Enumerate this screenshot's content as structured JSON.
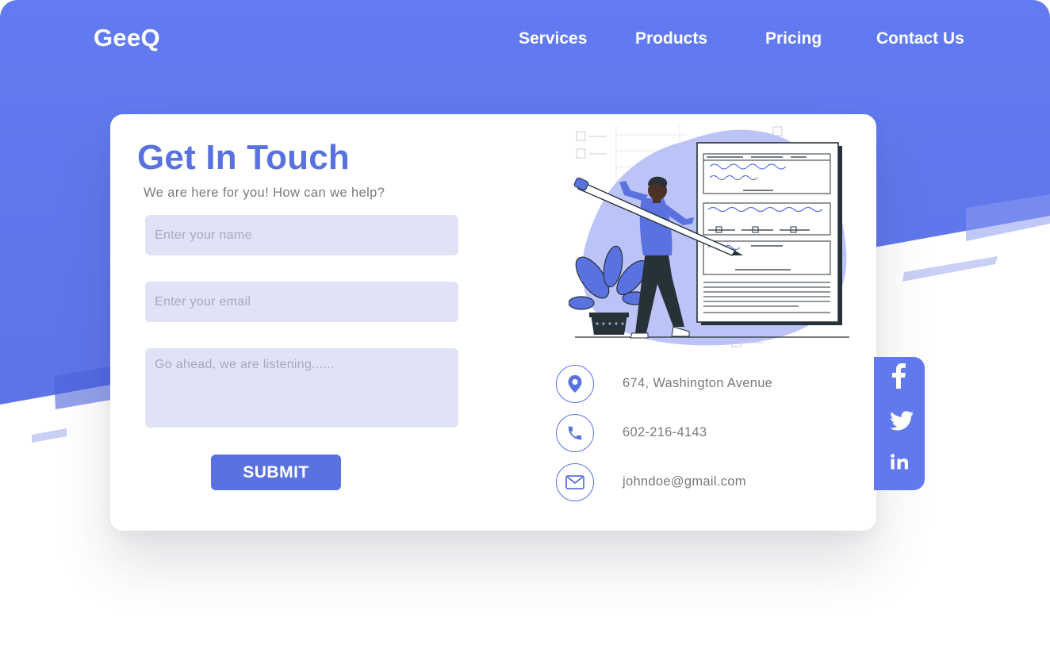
{
  "brand": {
    "name": "GeeQ"
  },
  "nav": {
    "items": [
      {
        "label": "Services"
      },
      {
        "label": "Products"
      },
      {
        "label": "Pricing"
      },
      {
        "label": "Contact Us"
      }
    ]
  },
  "contact_form": {
    "title": "Get In Touch",
    "subtitle": "We are here for you! How can we help?",
    "name_placeholder": "Enter your name",
    "email_placeholder": "Enter your email",
    "message_placeholder": "Go ahead, we are listening......",
    "submit_label": "SUBMIT"
  },
  "contact_info": {
    "address": {
      "icon": "map-pin-icon",
      "text": "674, Washington Avenue"
    },
    "phone": {
      "icon": "phone-icon",
      "text": "602-216-4143"
    },
    "email": {
      "icon": "envelope-icon",
      "text": "johndoe@gmail.com"
    }
  },
  "social": [
    {
      "icon": "facebook-icon"
    },
    {
      "icon": "twitter-icon"
    },
    {
      "icon": "linkedin-icon"
    }
  ],
  "colors": {
    "header_bg": "#5f78ec",
    "accent": "#5a72e0",
    "field_bg": "#e0e3f6",
    "social_bg": "#6279ee"
  }
}
